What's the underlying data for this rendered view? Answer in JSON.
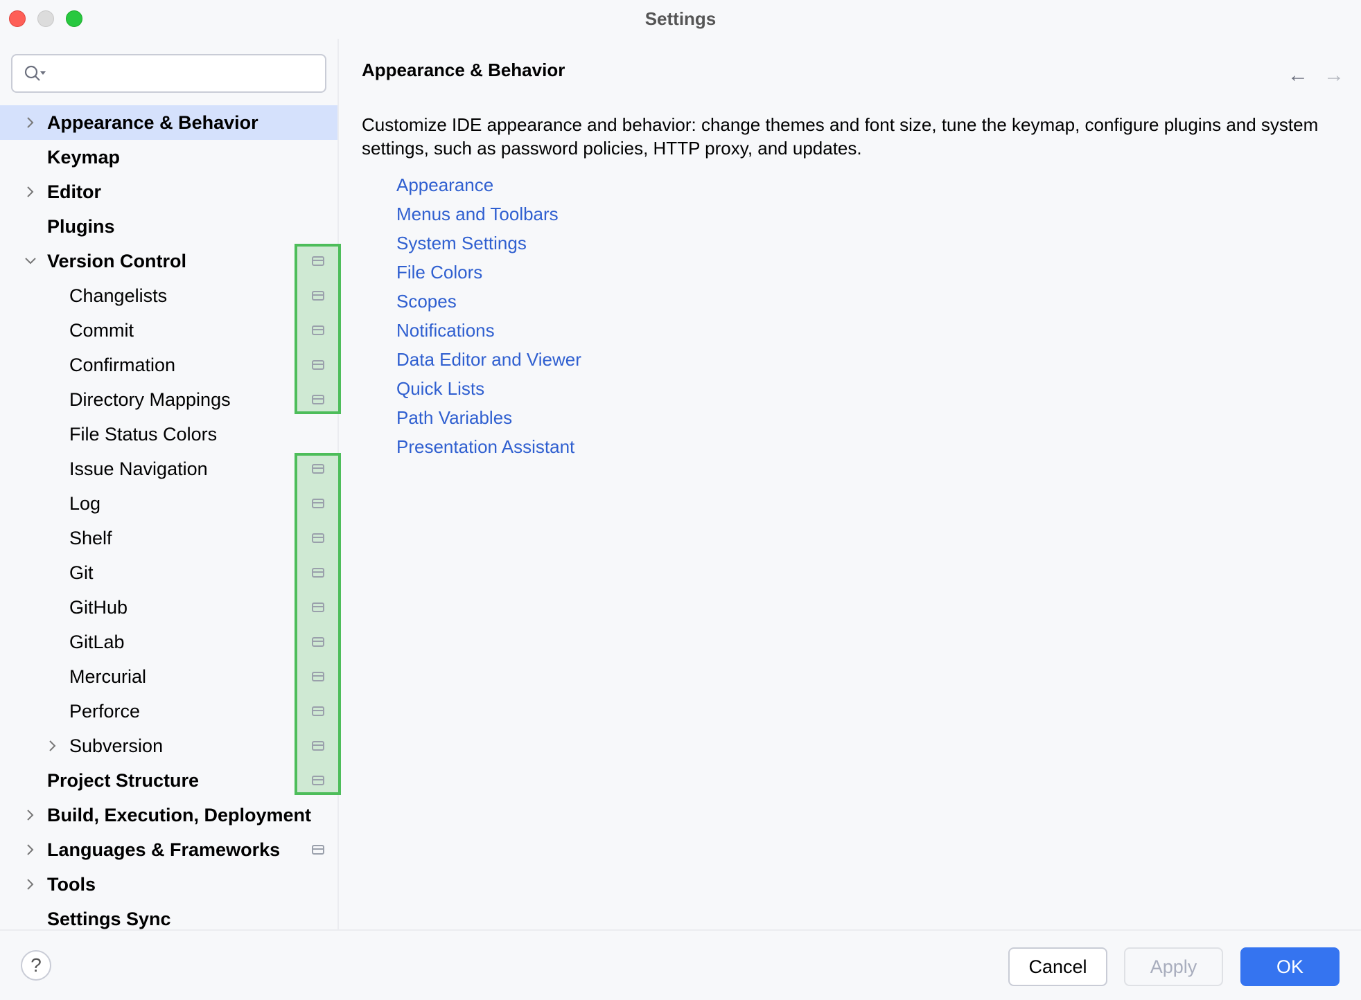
{
  "window": {
    "title": "Settings"
  },
  "search": {
    "placeholder": ""
  },
  "tree": [
    {
      "label": "Appearance & Behavior",
      "level": 0,
      "bold": true,
      "chevron": "right",
      "selected": true,
      "icon": false
    },
    {
      "label": "Keymap",
      "level": 0,
      "bold": true,
      "chevron": null,
      "icon": false
    },
    {
      "label": "Editor",
      "level": 0,
      "bold": true,
      "chevron": "right",
      "icon": false
    },
    {
      "label": "Plugins",
      "level": 0,
      "bold": true,
      "chevron": null,
      "icon": false
    },
    {
      "label": "Version Control",
      "level": 0,
      "bold": true,
      "chevron": "down",
      "icon": true
    },
    {
      "label": "Changelists",
      "level": 1,
      "icon": true
    },
    {
      "label": "Commit",
      "level": 1,
      "icon": true
    },
    {
      "label": "Confirmation",
      "level": 1,
      "icon": true
    },
    {
      "label": "Directory Mappings",
      "level": 1,
      "icon": true
    },
    {
      "label": "File Status Colors",
      "level": 1,
      "icon": false
    },
    {
      "label": "Issue Navigation",
      "level": 1,
      "icon": true
    },
    {
      "label": "Log",
      "level": 1,
      "icon": true
    },
    {
      "label": "Shelf",
      "level": 1,
      "icon": true
    },
    {
      "label": "Git",
      "level": 1,
      "icon": true
    },
    {
      "label": "GitHub",
      "level": 1,
      "icon": true
    },
    {
      "label": "GitLab",
      "level": 1,
      "icon": true
    },
    {
      "label": "Mercurial",
      "level": 1,
      "icon": true
    },
    {
      "label": "Perforce",
      "level": 1,
      "icon": true
    },
    {
      "label": "Subversion",
      "level": 1,
      "chevron": "right",
      "icon": true
    },
    {
      "label": "Project Structure",
      "level": 0,
      "bold": true,
      "icon": true
    },
    {
      "label": "Build, Execution, Deployment",
      "level": 0,
      "bold": true,
      "chevron": "right",
      "icon": false
    },
    {
      "label": "Languages & Frameworks",
      "level": 0,
      "bold": true,
      "chevron": "right",
      "icon": true
    },
    {
      "label": "Tools",
      "level": 0,
      "bold": true,
      "chevron": "right",
      "icon": false
    },
    {
      "label": "Settings Sync",
      "level": 0,
      "bold": true,
      "icon": false
    }
  ],
  "main": {
    "header": "Appearance & Behavior",
    "back_icon": "arrow-left-icon",
    "forward_icon": "arrow-right-icon",
    "description": "Customize IDE appearance and behavior: change themes and font size, tune the keymap, configure plugins and system settings, such as password policies, HTTP proxy, and updates.",
    "links": [
      "Appearance",
      "Menus and Toolbars",
      "System Settings",
      "File Colors",
      "Scopes",
      "Notifications",
      "Data Editor and Viewer",
      "Quick Lists",
      "Path Variables",
      "Presentation Assistant"
    ]
  },
  "footer": {
    "help": "?",
    "cancel": "Cancel",
    "apply": "Apply",
    "ok": "OK"
  },
  "colors": {
    "accent": "#3574f0",
    "link": "#2f5fd0",
    "selection": "#d5e1fc",
    "highlight_border": "#4dbd5a",
    "highlight_fill": "#cfe9d3"
  }
}
